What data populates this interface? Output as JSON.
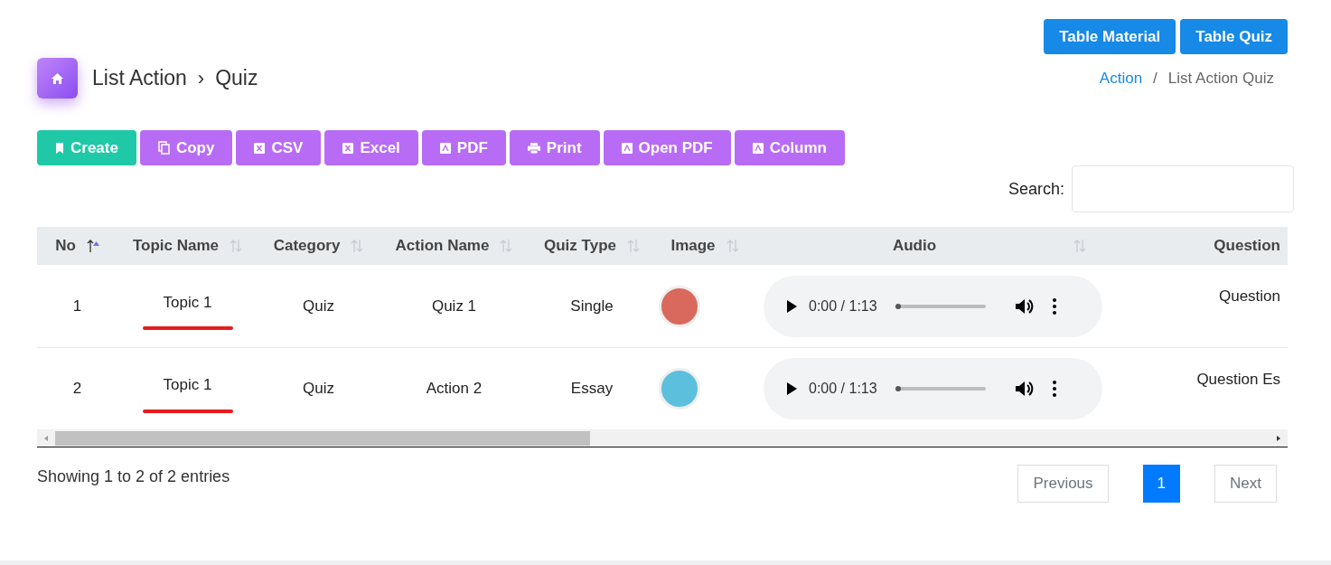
{
  "top_buttons": [
    "Table Material",
    "Table Quiz"
  ],
  "title": {
    "parent": "List Action",
    "separator": "›",
    "current": "Quiz"
  },
  "breadcrumb": {
    "link": "Action",
    "separator": "/",
    "current": "List Action Quiz"
  },
  "toolbar": [
    {
      "label": "Create",
      "kind": "create"
    },
    {
      "label": "Copy",
      "kind": "copy"
    },
    {
      "label": "CSV",
      "kind": "csv"
    },
    {
      "label": "Excel",
      "kind": "excel"
    },
    {
      "label": "PDF",
      "kind": "pdf"
    },
    {
      "label": "Print",
      "kind": "print"
    },
    {
      "label": "Open PDF",
      "kind": "pdf"
    },
    {
      "label": "Column",
      "kind": "pdf"
    }
  ],
  "search": {
    "label": "Search:"
  },
  "table": {
    "columns": [
      {
        "label": "No",
        "sorted": true
      },
      {
        "label": "Topic Name",
        "sorted": false
      },
      {
        "label": "Category",
        "sorted": false
      },
      {
        "label": "Action Name",
        "sorted": false
      },
      {
        "label": "Quiz Type",
        "sorted": false
      },
      {
        "label": "Image",
        "sorted": false
      },
      {
        "label": "Audio",
        "sorted": false
      },
      {
        "label": "Question"
      }
    ],
    "rows": [
      {
        "no": "1",
        "topic": "Topic 1",
        "category": "Quiz",
        "action": "Quiz 1",
        "quiz_type": "Single",
        "audio": {
          "time": "0:00 / 1:13",
          "level": 0
        },
        "question": "Question"
      },
      {
        "no": "2",
        "topic": "Topic 1",
        "category": "Quiz",
        "action": "Action 2",
        "quiz_type": "Essay",
        "audio": {
          "time": "0:00 / 1:13",
          "level": 0
        },
        "question": "Question Es"
      }
    ]
  },
  "info": "Showing 1 to 2 of 2 entries",
  "pagination": [
    {
      "label": "Previous",
      "selected": false
    },
    {
      "label": "1",
      "selected": true
    },
    {
      "label": "Next",
      "selected": false
    }
  ]
}
